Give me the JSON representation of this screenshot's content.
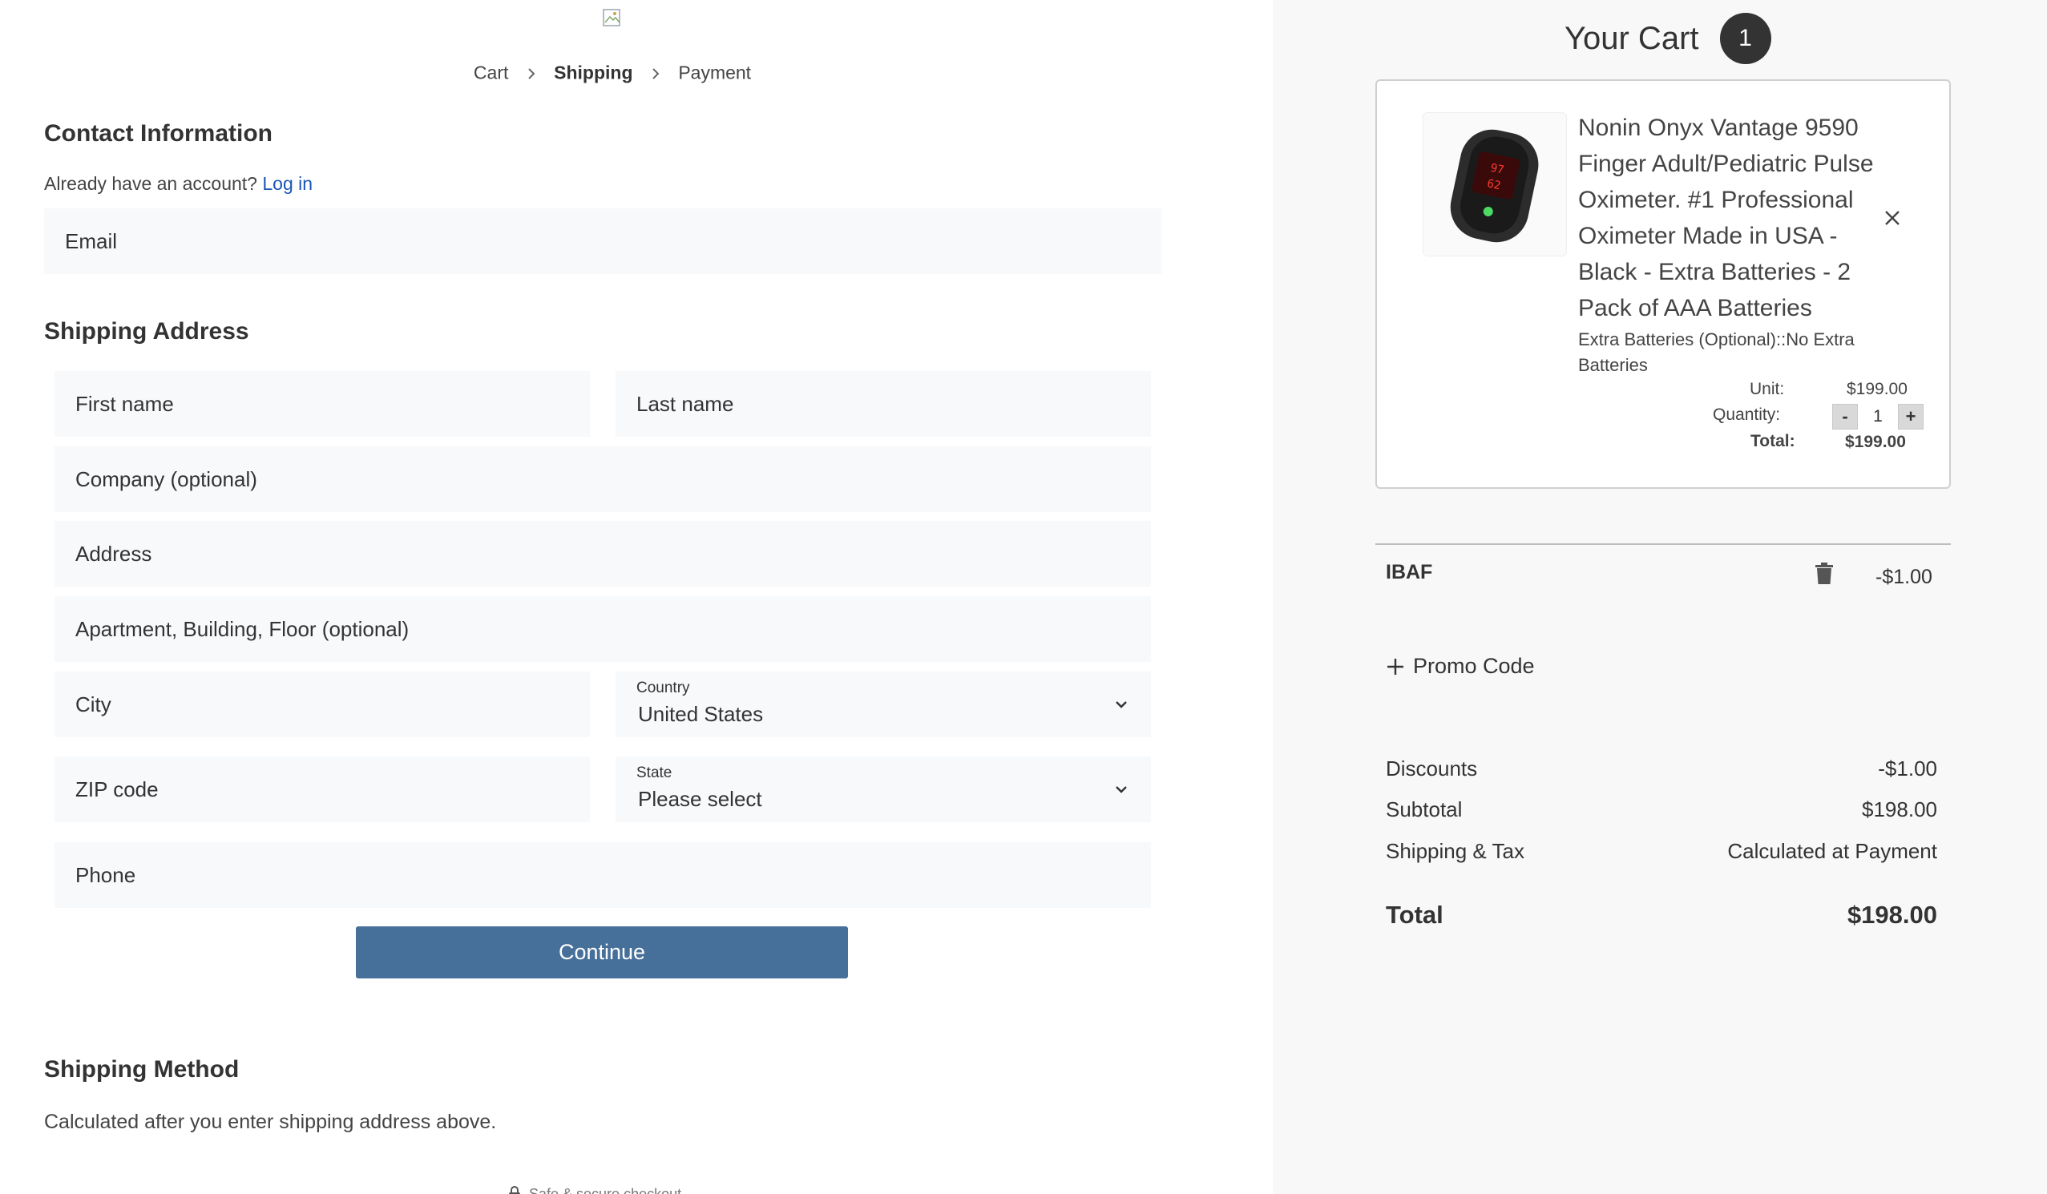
{
  "breadcrumb": {
    "cart": "Cart",
    "shipping": "Shipping",
    "payment": "Payment"
  },
  "contact": {
    "title": "Contact Information",
    "account_prompt": "Already have an account?",
    "login_link": "Log in",
    "email_placeholder": "Email"
  },
  "shipping_address": {
    "title": "Shipping Address",
    "first_name": "First name",
    "last_name": "Last name",
    "company": "Company (optional)",
    "address": "Address",
    "apartment": "Apartment, Building, Floor (optional)",
    "city": "City",
    "country_label": "Country",
    "country_value": "United States",
    "zip": "ZIP code",
    "state_label": "State",
    "state_value": "Please select",
    "phone": "Phone"
  },
  "continue_label": "Continue",
  "shipping_method": {
    "title": "Shipping Method",
    "note": "Calculated after you enter shipping address above."
  },
  "secure_text": "Safe & secure checkout",
  "cart": {
    "title": "Your Cart",
    "count": "1",
    "item": {
      "name": "Nonin Onyx Vantage 9590 Finger Adult/Pediatric Pulse Oximeter. #1 Professional Oximeter Made in USA - Black - Extra Batteries - 2 Pack of AAA Batteries",
      "variant": "Extra Batteries (Optional)::No Extra Batteries",
      "unit_label": "Unit:",
      "unit_price": "$199.00",
      "quantity_label": "Quantity:",
      "quantity": "1",
      "qty_minus": "-",
      "qty_plus": "+",
      "total_label": "Total:",
      "total": "$199.00"
    },
    "promo": {
      "code": "IBAF",
      "amount": "-$1.00",
      "add_label": "Promo Code"
    },
    "summary": {
      "discounts_label": "Discounts",
      "discounts": "-$1.00",
      "subtotal_label": "Subtotal",
      "subtotal": "$198.00",
      "shipping_label": "Shipping & Tax",
      "shipping": "Calculated at Payment",
      "total_label": "Total",
      "total": "$198.00"
    }
  },
  "icons": {
    "broken_logo": "broken-image-icon",
    "separator": "chevron-right-icon",
    "select": "chevron-down-icon",
    "remove": "close-icon",
    "delete": "trash-icon",
    "add": "plus-icon",
    "secure": "lock-icon"
  },
  "colors": {
    "accent_button": "#466f99",
    "link": "#1a56b5",
    "badge": "#333333"
  }
}
